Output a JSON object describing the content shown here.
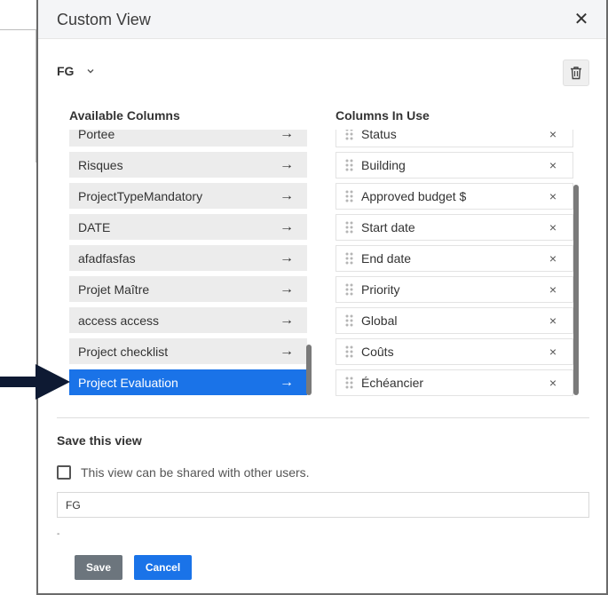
{
  "dialog": {
    "title": "Custom View",
    "close_glyph": "✕"
  },
  "view_selector": {
    "selected": "FG"
  },
  "available_columns": {
    "heading": "Available Columns",
    "items": [
      {
        "label": "Portee"
      },
      {
        "label": "Risques"
      },
      {
        "label": "ProjectTypeMandatory"
      },
      {
        "label": "DATE"
      },
      {
        "label": "afadfasfas"
      },
      {
        "label": "Projet Maître"
      },
      {
        "label": "access access"
      },
      {
        "label": "Project checklist"
      },
      {
        "label": "Project Evaluation",
        "selected": true
      }
    ],
    "arrow_glyph": "→"
  },
  "columns_in_use": {
    "heading": "Columns In Use",
    "items": [
      {
        "label": "Status"
      },
      {
        "label": "Building"
      },
      {
        "label": "Approved budget $"
      },
      {
        "label": "Start date"
      },
      {
        "label": "End date"
      },
      {
        "label": "Priority"
      },
      {
        "label": "Global"
      },
      {
        "label": "Coûts"
      },
      {
        "label": "Échéancier"
      }
    ],
    "remove_glyph": "×"
  },
  "save_section": {
    "title": "Save this view",
    "share_label": "This view can be shared with other users.",
    "share_checked": false,
    "name_value": "FG",
    "save_label": "Save",
    "cancel_label": "Cancel"
  },
  "colors": {
    "selected_bg": "#1a73e8",
    "cancel_bg": "#1a73e8",
    "save_bg": "#6c757d",
    "item_bg": "#ececec",
    "pointer_arrow": "#0e1a33"
  }
}
